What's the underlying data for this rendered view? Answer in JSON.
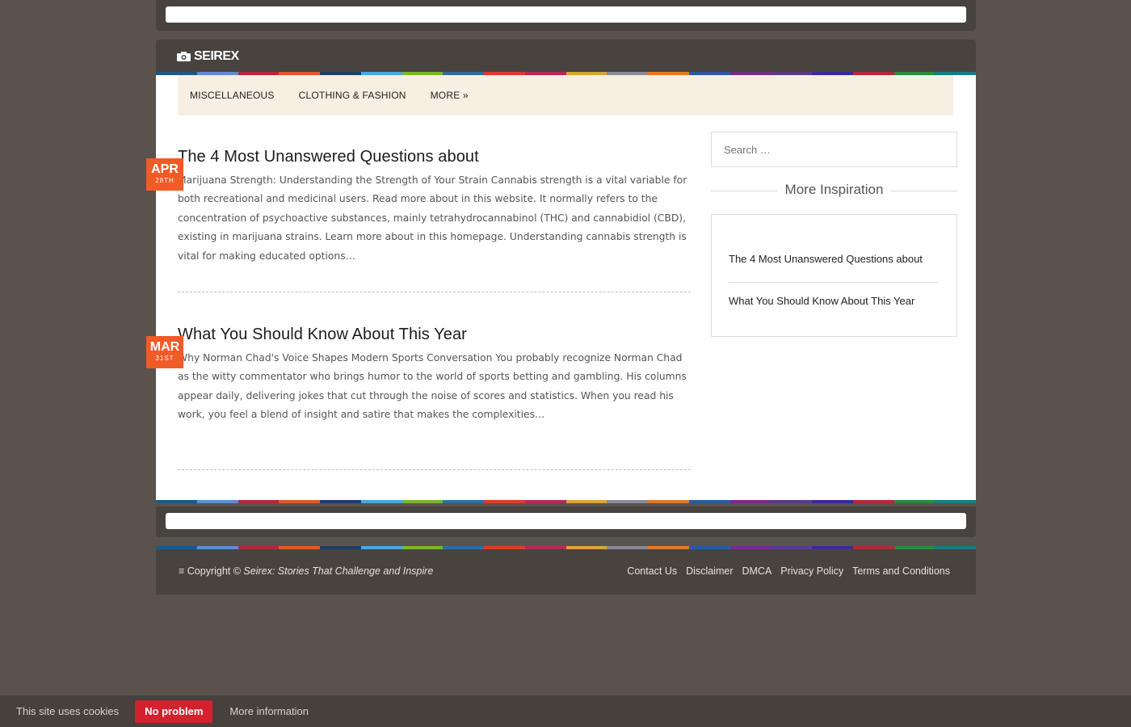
{
  "site": {
    "logo_text": "SEIREX"
  },
  "nav": {
    "items": [
      {
        "label": "MISCELLANEOUS"
      },
      {
        "label": "CLOTHING & FASHION"
      },
      {
        "label": "MORE »"
      }
    ]
  },
  "posts": [
    {
      "month": "APR",
      "day": "28TH",
      "title": "The 4 Most Unanswered Questions about",
      "excerpt": "Marijuana Strength: Understanding the Strength of Your Strain Cannabis strength is a vital variable for both recreational and medicinal users. Read more about in this website. It normally refers to the concentration of psychoactive substances, mainly tetrahydrocannabinol (THC) and cannabidiol (CBD), existing in marijuana strains. Learn more about in this homepage. Understanding cannabis strength is vital for making educated options…"
    },
    {
      "month": "MAR",
      "day": "31ST",
      "title": "What You Should Know About This Year",
      "excerpt": "Why Norman Chad's Voice Shapes Modern Sports Conversation You probably recognize Norman Chad as the witty commentator who brings humor to the world of sports betting and gambling. His columns appear daily, delivering jokes that cut through the noise of scores and statistics. When you read his work, you feel a blend of insight and satire that makes the complexities…"
    }
  ],
  "sidebar": {
    "search_placeholder": "Search …",
    "widget_title": "More Inspiration",
    "links": [
      {
        "label": "The 4 Most Unanswered Questions about"
      },
      {
        "label": "What You Should Know About This Year"
      }
    ]
  },
  "footer": {
    "copyright_prefix": "≡ Copyright © ",
    "copyright_site": "Seirex: Stories That Challenge and Inspire",
    "links": [
      {
        "label": "Contact Us"
      },
      {
        "label": "Disclaimer"
      },
      {
        "label": "DMCA"
      },
      {
        "label": "Privacy Policy"
      },
      {
        "label": "Terms and Conditions"
      }
    ]
  },
  "cookie": {
    "text": "This site uses cookies",
    "accept_label": "No problem",
    "more_label": "More information"
  },
  "colors": {
    "background": "#5a524c",
    "frame": "#48433f",
    "nav_background": "#f6efe2",
    "date_badge": "#f25a28",
    "cookie_button": "#d3212d",
    "stripe": [
      "#1a5a8a",
      "#5d8fd1",
      "#b3283a",
      "#e05a2a",
      "#1a3f6a",
      "#4aa7e0",
      "#7ab82f",
      "#2d6ea0",
      "#e03a2a",
      "#b32a5a",
      "#d9a43a",
      "#8a8a9a",
      "#e07a2a",
      "#2a5aa0",
      "#7a2a8a",
      "#5a3a8a",
      "#3a2a9a",
      "#b3283a",
      "#2a8a3a",
      "#1a7a8a"
    ]
  }
}
